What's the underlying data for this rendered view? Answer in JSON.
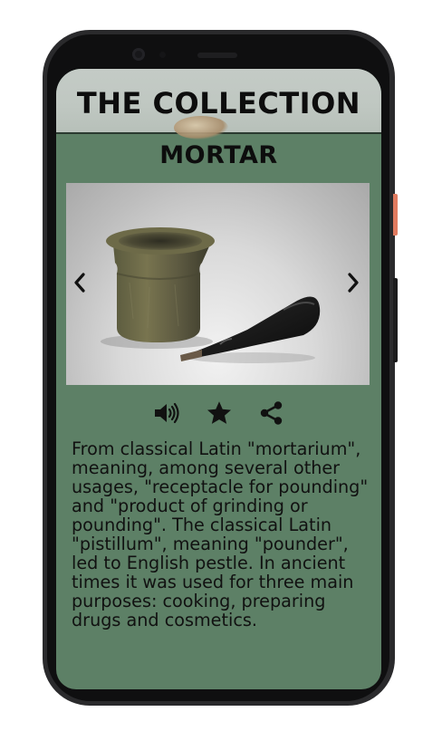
{
  "header": {
    "title": "THE COLLECTION"
  },
  "item": {
    "name": "MORTAR",
    "image_alt": "Stone mortar and dark pestle",
    "description": "From classical Latin \"mortarium\", meaning, among several other usages, \"receptacle for pounding\" and \"product of grinding or pounding\". The classical Latin \"pistillum\", meaning \"pounder\", led to English pestle. In ancient times it was used for three main purposes: cooking, preparing drugs and cosmetics."
  },
  "icons": {
    "prev": "chevron-left-icon",
    "next": "chevron-right-icon",
    "audio": "speaker-icon",
    "favorite": "star-icon",
    "share": "share-icon"
  },
  "colors": {
    "screen_bg": "#5d8066",
    "text": "#0d0d0d",
    "header_bg": "#c4cbc6"
  }
}
